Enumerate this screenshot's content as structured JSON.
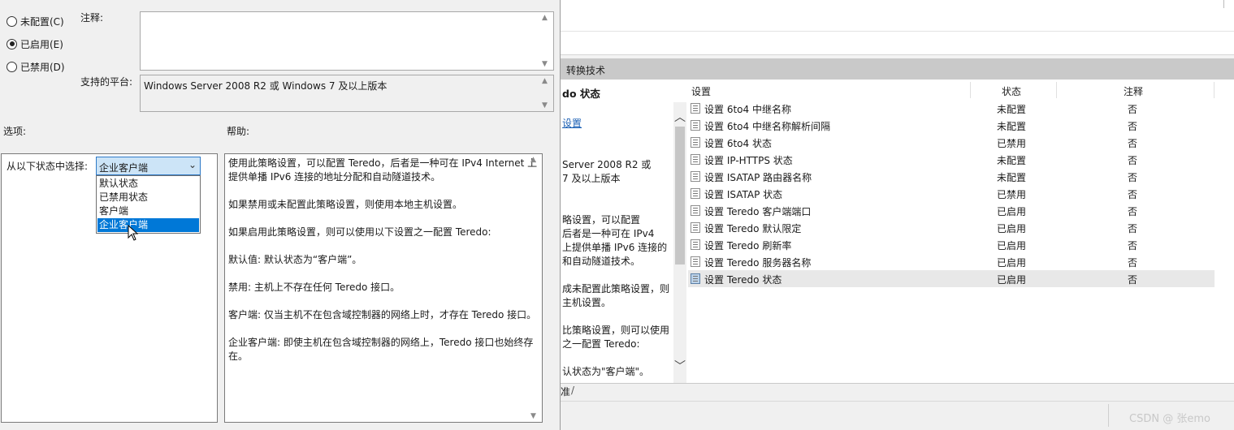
{
  "dialog": {
    "radios": [
      {
        "label": "未配置(C)",
        "checked": false
      },
      {
        "label": "已启用(E)",
        "checked": true
      },
      {
        "label": "已禁用(D)",
        "checked": false
      }
    ],
    "comment_label": "注释:",
    "platform_label": "支持的平台:",
    "platform_value": "Windows Server 2008 R2 或 Windows 7 及以上版本",
    "options_label": "选项:",
    "help_label": "帮助:",
    "select_label": "从以下状态中选择:",
    "dropdown": {
      "selected": "企业客户端",
      "options": [
        "默认状态",
        "已禁用状态",
        "客户端",
        "企业客户端"
      ]
    },
    "help": [
      "使用此策略设置，可以配置 Teredo，后者是一种可在 IPv4 Internet 上提供单播 IPv6 连接的地址分配和自动隧道技术。",
      "如果禁用或未配置此策略设置，则使用本地主机设置。",
      "如果启用此策略设置，则可以使用以下设置之一配置 Teredo:",
      "默认值: 默认状态为“客户端”。",
      "禁用: 主机上不存在任何 Teredo 接口。",
      "客户端: 仅当主机不在包含域控制器的网络上时，才存在 Teredo 接口。",
      "企业客户端: 即使主机在包含域控制器的网络上，Teredo 接口也始终存在。"
    ]
  },
  "editor": {
    "tab_label": "转换技术",
    "desc": {
      "title": "do 状态",
      "link": "设置",
      "lines": [
        "Server 2008 R2 或",
        "7 及以上版本",
        "略设置，可以配置",
        "后者是一种可在 IPv4",
        "上提供单播 IPv6 连接的",
        "和自动隧道技术。",
        "成未配置此策略设置，则",
        "主机设置。",
        "比策略设置，则可以使用",
        "之一配置 Teredo:",
        "认状态为\"客户端\"。"
      ]
    },
    "columns": {
      "setting": "设置",
      "state": "状态",
      "comment": "注释"
    },
    "rows": [
      {
        "name": "设置 6to4 中继名称",
        "state": "未配置",
        "comment": "否"
      },
      {
        "name": "设置 6to4 中继名称解析间隔",
        "state": "未配置",
        "comment": "否"
      },
      {
        "name": "设置 6to4 状态",
        "state": "已禁用",
        "comment": "否"
      },
      {
        "name": "设置 IP-HTTPS 状态",
        "state": "未配置",
        "comment": "否"
      },
      {
        "name": "设置 ISATAP 路由器名称",
        "state": "未配置",
        "comment": "否"
      },
      {
        "name": "设置 ISATAP 状态",
        "state": "已禁用",
        "comment": "否"
      },
      {
        "name": "设置 Teredo 客户端端口",
        "state": "已启用",
        "comment": "否"
      },
      {
        "name": "设置 Teredo 默认限定",
        "state": "已启用",
        "comment": "否"
      },
      {
        "name": "设置 Teredo 刷新率",
        "state": "已启用",
        "comment": "否"
      },
      {
        "name": "设置 Teredo 服务器名称",
        "state": "已启用",
        "comment": "否"
      },
      {
        "name": "设置 Teredo 状态",
        "state": "已启用",
        "comment": "否"
      }
    ],
    "bottom_tab": "准",
    "watermark": "CSDN @    张emo"
  }
}
